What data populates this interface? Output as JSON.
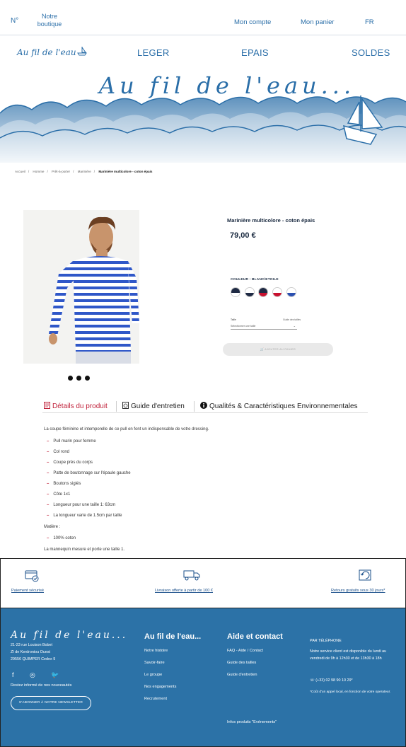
{
  "topbar": {
    "store_no": "N°",
    "store_label": "Notre boutique",
    "account": "Mon compte",
    "cart": "Mon panier",
    "lang": "FR"
  },
  "nav": {
    "logo": "Au fil de l'eau",
    "items": [
      "LEGER",
      "EPAIS",
      "SOLDES"
    ]
  },
  "hero": {
    "script": "Au fil de l'eau..."
  },
  "breadcrumb": [
    "Accueil",
    "Homme",
    "Prêt-à-porter",
    "Marinière",
    "Marinière multicolore - coton épais"
  ],
  "product": {
    "title": "Marinière multicolore - coton épais",
    "price": "79,00 €",
    "color_label": "COULEUR : BLANC/ETOILE",
    "size_label": "Taille",
    "size_guide": "Guide des tailles",
    "size_placeholder": "Sélectionner une taille",
    "add_to_cart": "AJOUTER AU PANIER",
    "swatches": [
      {
        "top": "#1f2a44",
        "bottom": "#ffffff"
      },
      {
        "top": "#ffffff",
        "bottom": "#1f2a44"
      },
      {
        "top": "#1f2a44",
        "bottom": "#c8102e"
      },
      {
        "top": "#ffffff",
        "bottom": "#c8102e"
      },
      {
        "top": "#ffffff",
        "bottom": "#2a4fb0"
      }
    ]
  },
  "tabs": {
    "details": "Détails du produit",
    "care": "Guide d'entretien",
    "env": "Qualités & Caractéristiques Environnementales"
  },
  "description": {
    "intro": "La coupe féminine et intemporelle de ce pull en font un indispensable de votre dressing.",
    "bullets": [
      "Pull marin pour femme",
      "Col rond",
      "Coupe près du corps",
      "Patte de boutonnage sur l'épaule gauche",
      "Boutons siglés",
      "Côte 1x1",
      "Longueur pour une taille 1: 63cm",
      "La longueur varie de 1.5cm par taille"
    ],
    "material_label": "Matière :",
    "material": "100% coton",
    "model": "La mannequin mesure et porte une taille 1."
  },
  "services": {
    "payment": "Paiement sécurisé",
    "delivery": "Livraison offerte à partir de 100 €",
    "returns": "Retours gratuits sous 30 jours*"
  },
  "footer": {
    "logo": "Au fil de l'eau...",
    "address": [
      "21-23 rue Louison Bobet",
      "ZI de Kerdroniou Ouest",
      "29556 QUIMPER Cedex 9"
    ],
    "newsletter_text": "Restez informé de nos nouveautés",
    "newsletter_btn": "S'ABONNER À NOTRE NEWSLETTER",
    "col1_title": "Au fil de l'eau...",
    "col1_links": [
      "Notre histoire",
      "Savoir-faire",
      "Le groupe",
      "Nos engagements",
      "Recrutement"
    ],
    "col2_title": "Aide et contact",
    "col2_links": [
      "FAQ - Aide / Contact",
      "Guide des tailles",
      "Guide d'entretien"
    ],
    "col2_extra": "Infos produits \"Evénements\"",
    "phone_title": "PAR TÉLÉPHONE",
    "phone_text": "Notre service client est disponible du lundi au vendredi de 9h à 12h30 et de 13h30 à 18h",
    "phone_number": "(+33) 02 98 90 10 29*",
    "phone_note": "*Coût d'un appel local, en fonction de votre operateur."
  }
}
